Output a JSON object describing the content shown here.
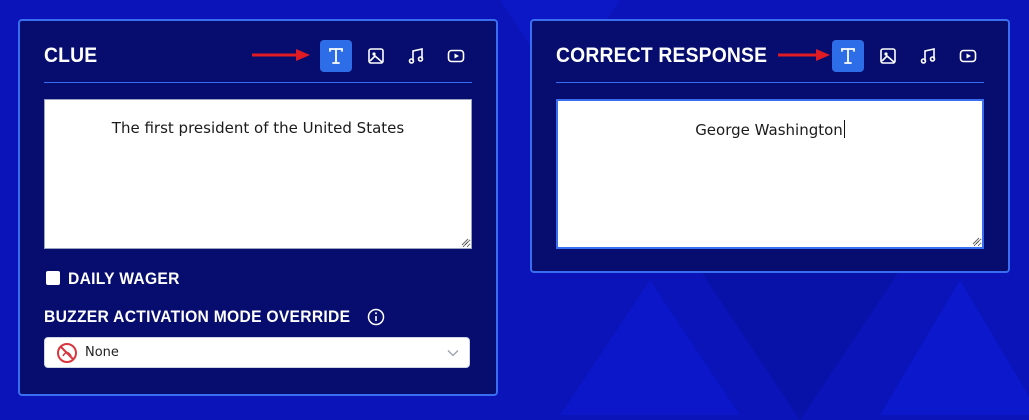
{
  "colors": {
    "background": "#0a14b8",
    "panel": "#060d6e",
    "panel_border": "#3a6ef0",
    "active_button": "#2e6de8",
    "arrow": "#e01b24"
  },
  "clue": {
    "title": "CLUE",
    "media_types": [
      {
        "name": "text-icon",
        "active": true
      },
      {
        "name": "image-icon",
        "active": false
      },
      {
        "name": "music-icon",
        "active": false
      },
      {
        "name": "video-icon",
        "active": false
      }
    ],
    "text": "The first president of the United States",
    "daily_wager_label": "DAILY WAGER",
    "daily_wager_checked": false,
    "buzzer_label": "BUZZER ACTIVATION MODE OVERRIDE",
    "buzzer_icon": "info-icon",
    "buzzer_select_value": "None",
    "buzzer_select_icon": "prohibited-icon"
  },
  "response": {
    "title": "CORRECT RESPONSE",
    "media_types": [
      {
        "name": "text-icon",
        "active": true
      },
      {
        "name": "image-icon",
        "active": false
      },
      {
        "name": "music-icon",
        "active": false
      },
      {
        "name": "video-icon",
        "active": false
      }
    ],
    "text": "George Washington"
  }
}
